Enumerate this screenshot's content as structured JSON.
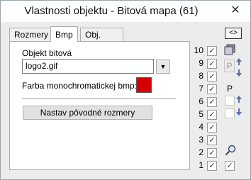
{
  "window": {
    "title": "Vlastnosti objektu - Bitová mapa (61)",
    "close_glyph": "✕"
  },
  "tabs": [
    {
      "label": "Rozmery"
    },
    {
      "label": "Bmp"
    },
    {
      "label": "Obj. manažér"
    }
  ],
  "bmp_tab": {
    "object_label": "Objekt bitová",
    "object_value": "logo2.gif",
    "dropdown_glyph": "▼",
    "mono_label": "Farba monochromatickej bmp:",
    "mono_color": "#d40000",
    "reset_button": "Nastav pôvodné rozmery"
  },
  "layer_panel": {
    "toggle_label": "<>",
    "layers": [
      {
        "num": "10",
        "checked": true
      },
      {
        "num": "9",
        "checked": true
      },
      {
        "num": "8",
        "checked": true
      },
      {
        "num": "7",
        "checked": true
      },
      {
        "num": "6",
        "checked": true
      },
      {
        "num": "5",
        "checked": true
      },
      {
        "num": "4",
        "checked": true
      },
      {
        "num": "3",
        "checked": true
      },
      {
        "num": "2",
        "checked": true
      },
      {
        "num": "1",
        "checked": true
      }
    ],
    "p_label_top": "P",
    "p_label": "P",
    "check_glyph": "✓"
  }
}
